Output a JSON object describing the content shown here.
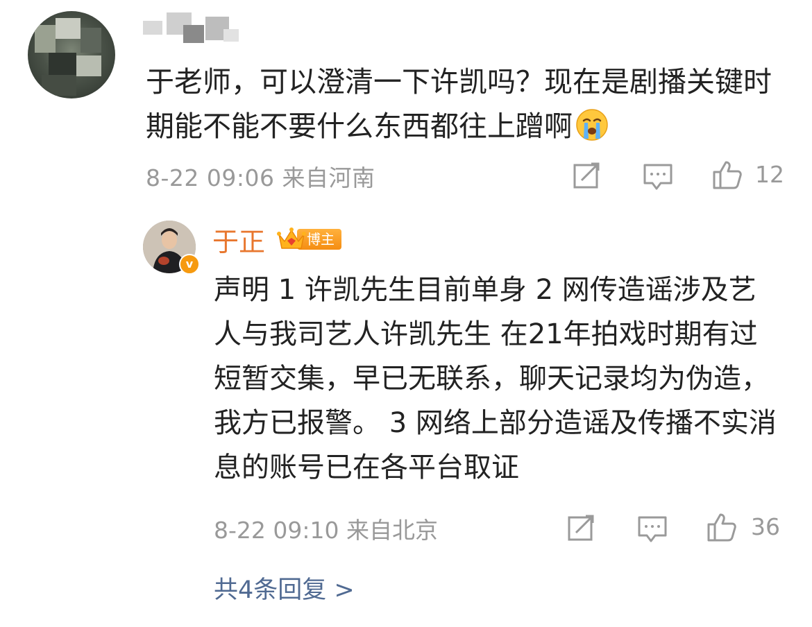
{
  "comment": {
    "text": "于老师，可以澄清一下许凯吗？现在是剧播关键时期能不能不要什么东西都往上蹭啊",
    "emoji_icon": "crying-face-icon",
    "meta": "8-22 09:06 来自河南",
    "likes": "12"
  },
  "reply": {
    "author": "于正",
    "badge": "博主",
    "verified_icon": "verified-v-icon",
    "text": "声明 1 许凯先生目前单身 2 网传造谣涉及艺人与我司艺人许凯先生 在21年拍戏时期有过短暂交集，早已无联系，聊天记录均为伪造，我方已报警。 3 网络上部分造谣及传播不实消息的账号已在各平台取证",
    "meta": "8-22 09:10 来自北京",
    "likes": "36"
  },
  "more_replies": "共4条回复 >",
  "colors": {
    "meta_gray": "#999999",
    "author_orange": "#e8772e",
    "badge_orange": "#f58d12",
    "link_blue": "#506a92"
  }
}
